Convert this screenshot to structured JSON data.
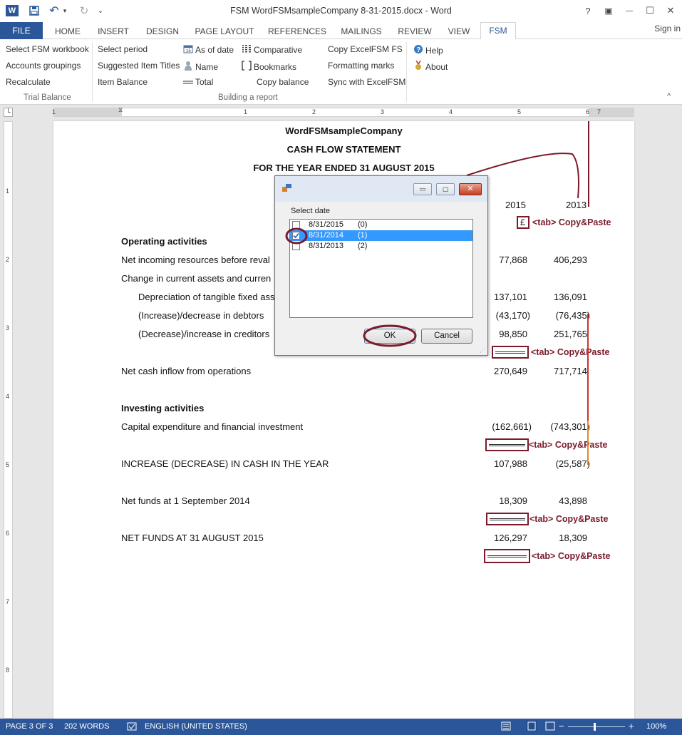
{
  "window": {
    "title": "FSM WordFSMsampleCompany 8-31-2015.docx - Word",
    "help": "?",
    "restore": "▣",
    "minimize": "—",
    "maximize": "☐",
    "close": "✕"
  },
  "quick_access": {
    "app_icon": "W",
    "save_icon": "💾",
    "undo_icon": "↶",
    "redo_icon": "↻",
    "more_icon": "⌄"
  },
  "tabs": [
    "FILE",
    "HOME",
    "INSERT",
    "DESIGN",
    "PAGE LAYOUT",
    "REFERENCES",
    "MAILINGS",
    "REVIEW",
    "VIEW",
    "FSM"
  ],
  "active_tab": "FSM",
  "signin": "Sign in",
  "ribbon": {
    "trial_balance": {
      "items": [
        "Select FSM workbook",
        "Accounts groupings",
        "Recalculate"
      ],
      "label": "Trial Balance"
    },
    "building": {
      "col1": [
        "Select period",
        "Suggested Item Titles",
        "Item Balance"
      ],
      "col2": [
        "As of date",
        "Name",
        "Total"
      ],
      "col3": [
        "Comparative",
        "Bookmarks",
        "Copy balance"
      ],
      "col4": [
        "Copy ExcelFSM FS",
        "Formatting marks",
        "Sync with ExcelFSM"
      ],
      "label": "Building a report"
    },
    "help": [
      "Help",
      "About"
    ],
    "collapse": "^"
  },
  "ruler": {
    "h_numbers": [
      "1",
      "1",
      "2",
      "3",
      "4",
      "5",
      "6",
      "7"
    ],
    "v_numbers": [
      "1",
      "2",
      "3",
      "4",
      "5",
      "6",
      "7",
      "8"
    ]
  },
  "document": {
    "company": "WordFSMsampleCompany",
    "statement": "CASH FLOW STATEMENT",
    "period": "FOR THE YEAR ENDED 31 AUGUST 2015",
    "year_cur": "2015",
    "year_prev": "2013",
    "currency": "£",
    "rows": [
      {
        "label": "Operating activities",
        "bold": true,
        "cur": "",
        "prev": ""
      },
      {
        "label": "Net incoming resources before reval",
        "cur": "77,868",
        "prev": "406,293"
      },
      {
        "label": "Change in current assets and curren",
        "cur": "",
        "prev": ""
      },
      {
        "label": "Depreciation of tangible fixed ass",
        "cur": "137,101",
        "prev": "136,091",
        "indent": true
      },
      {
        "label": "(Increase)/decrease in debtors",
        "cur": "(43,170)",
        "prev": "(76,435)",
        "indent": true
      },
      {
        "label": "(Decrease)/increase in creditors",
        "cur": "98,850",
        "prev": "251,765",
        "indent": true
      },
      {
        "label": "Net cash inflow from operations",
        "cur": "270,649",
        "prev": "717,714"
      },
      {
        "label": "Investing activities",
        "bold": true,
        "cur": "",
        "prev": ""
      },
      {
        "label": "Capital expenditure and financial investment",
        "cur": "(162,661)",
        "prev": "(743,301)"
      },
      {
        "label": "INCREASE (DECREASE) IN CASH IN THE YEAR",
        "cur": "107,988",
        "prev": "(25,587)"
      },
      {
        "label": "Net funds at 1 September 2014",
        "cur": "18,309",
        "prev": "43,898"
      },
      {
        "label": "NET FUNDS AT 31 AUGUST 2015",
        "cur": "126,297",
        "prev": "18,309"
      }
    ],
    "annotation": "<tab>  Copy&Paste"
  },
  "dialog": {
    "label": "Select date",
    "items": [
      {
        "date": "8/31/2015",
        "index": "(0)",
        "checked": false,
        "selected": false
      },
      {
        "date": "8/31/2014",
        "index": "(1)",
        "checked": true,
        "selected": true
      },
      {
        "date": "8/31/2013",
        "index": "(2)",
        "checked": false,
        "selected": false
      }
    ],
    "ok": "OK",
    "cancel": "Cancel",
    "min": "▭",
    "max": "▢",
    "close": "✕"
  },
  "statusbar": {
    "page": "PAGE 3 OF 3",
    "words": "202 WORDS",
    "language": "ENGLISH (UNITED STATES)",
    "zoom": "100%",
    "minus": "−",
    "plus": "+"
  },
  "colors": {
    "brand": "#2b579a",
    "annotation": "#7b1a2a",
    "selection": "#3399ff"
  }
}
